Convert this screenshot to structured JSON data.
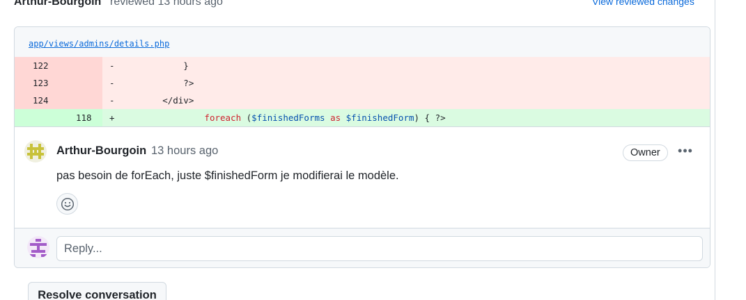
{
  "header": {
    "author": "Arthur-Bourgoin",
    "action": "reviewed 13 hours ago",
    "view_link": "View reviewed changes"
  },
  "file": {
    "path": "app/views/admins/details.php"
  },
  "diff": {
    "lines": [
      {
        "type": "del",
        "old": "122",
        "new": "",
        "marker": "-",
        "code": "            }"
      },
      {
        "type": "del",
        "old": "123",
        "new": "",
        "marker": "-",
        "code": "            ?>"
      },
      {
        "type": "del",
        "old": "124",
        "new": "",
        "marker": "-",
        "code": "        </div>"
      },
      {
        "type": "add",
        "old": "",
        "new": "118",
        "marker": "+",
        "code_parts": {
          "indent": "                ",
          "kw_foreach": "foreach",
          "open": " (",
          "var1": "$finishedForms",
          "sp1": " ",
          "kw_as": "as",
          "sp2": " ",
          "var2": "$finishedForm",
          "close": ") { ?>"
        }
      }
    ]
  },
  "comment": {
    "author": "Arthur-Bourgoin",
    "time": "13 hours ago",
    "badge": "Owner",
    "more_label": "•••",
    "body": "pas besoin de forEach, juste $finishedForm je modifierai le modèle."
  },
  "reply": {
    "placeholder": "Reply..."
  },
  "resolve": {
    "label": "Resolve conversation"
  },
  "colors": {
    "accent": "#0969da",
    "deleted_bg": "#ffebe9",
    "added_bg": "#dafbe1",
    "keyword": "#cf222e",
    "variable": "#0550ae",
    "avatar_commenter": "#c8c23a",
    "avatar_replier": "#a25bc8"
  },
  "icons": {
    "commenter_avatar": "identicon-avatar",
    "reply_avatar": "identicon-avatar",
    "reaction": "smiley-icon",
    "more": "kebab-horizontal-icon"
  }
}
